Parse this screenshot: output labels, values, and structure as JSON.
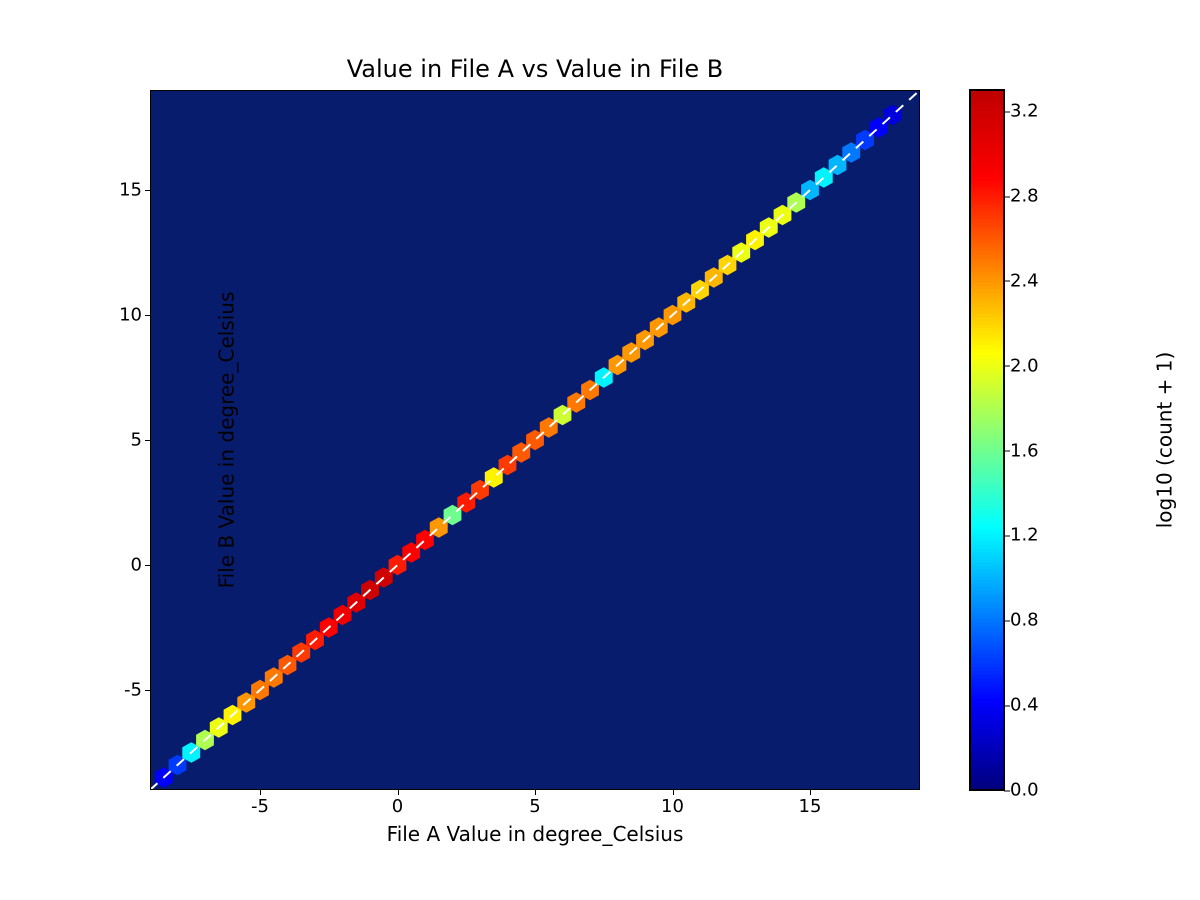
{
  "chart_data": {
    "type": "heatmap",
    "title": "Value in File A vs Value in File B",
    "xlabel": "File A Value in degree_Celsius",
    "ylabel": "File B Value in degree_Celsius",
    "xlim": [
      -9,
      19
    ],
    "ylim": [
      -9,
      19
    ],
    "xticks": [
      -5,
      0,
      5,
      10,
      15
    ],
    "yticks": [
      -5,
      0,
      5,
      10,
      15
    ],
    "colormap": "jet",
    "colorbar": {
      "label": "log10 (count + 1)",
      "min": 0.0,
      "max": 3.3,
      "ticks": [
        0.0,
        0.4,
        0.8,
        1.2,
        1.6,
        2.0,
        2.4,
        2.8,
        3.2
      ]
    },
    "overlay_line": {
      "style": "dashed",
      "color": "white",
      "equation": "y = x"
    },
    "diagonal_points": [
      {
        "x": -8.5,
        "v": 0.4
      },
      {
        "x": -8.0,
        "v": 0.6
      },
      {
        "x": -7.5,
        "v": 1.2
      },
      {
        "x": -7.0,
        "v": 1.8
      },
      {
        "x": -6.5,
        "v": 2.0
      },
      {
        "x": -6.0,
        "v": 2.1
      },
      {
        "x": -5.5,
        "v": 2.4
      },
      {
        "x": -5.0,
        "v": 2.5
      },
      {
        "x": -4.5,
        "v": 2.5
      },
      {
        "x": -4.0,
        "v": 2.6
      },
      {
        "x": -3.5,
        "v": 2.7
      },
      {
        "x": -3.0,
        "v": 2.8
      },
      {
        "x": -2.5,
        "v": 2.9
      },
      {
        "x": -2.0,
        "v": 3.0
      },
      {
        "x": -1.5,
        "v": 3.1
      },
      {
        "x": -1.0,
        "v": 3.2
      },
      {
        "x": -0.5,
        "v": 3.2
      },
      {
        "x": 0.0,
        "v": 2.8
      },
      {
        "x": 0.5,
        "v": 2.9
      },
      {
        "x": 1.0,
        "v": 2.9
      },
      {
        "x": 1.5,
        "v": 2.4
      },
      {
        "x": 2.0,
        "v": 1.6
      },
      {
        "x": 2.5,
        "v": 2.8
      },
      {
        "x": 3.0,
        "v": 2.7
      },
      {
        "x": 3.5,
        "v": 2.1
      },
      {
        "x": 4.0,
        "v": 2.7
      },
      {
        "x": 4.5,
        "v": 2.6
      },
      {
        "x": 5.0,
        "v": 2.6
      },
      {
        "x": 5.5,
        "v": 2.5
      },
      {
        "x": 6.0,
        "v": 1.9
      },
      {
        "x": 6.5,
        "v": 2.5
      },
      {
        "x": 7.0,
        "v": 2.5
      },
      {
        "x": 7.5,
        "v": 1.2
      },
      {
        "x": 8.0,
        "v": 2.4
      },
      {
        "x": 8.5,
        "v": 2.4
      },
      {
        "x": 9.0,
        "v": 2.4
      },
      {
        "x": 9.5,
        "v": 2.4
      },
      {
        "x": 10.0,
        "v": 2.4
      },
      {
        "x": 10.5,
        "v": 2.3
      },
      {
        "x": 11.0,
        "v": 2.2
      },
      {
        "x": 11.5,
        "v": 2.3
      },
      {
        "x": 12.0,
        "v": 2.2
      },
      {
        "x": 12.5,
        "v": 2.0
      },
      {
        "x": 13.0,
        "v": 2.1
      },
      {
        "x": 13.5,
        "v": 2.0
      },
      {
        "x": 14.0,
        "v": 2.0
      },
      {
        "x": 14.5,
        "v": 1.8
      },
      {
        "x": 15.0,
        "v": 1.0
      },
      {
        "x": 15.5,
        "v": 1.2
      },
      {
        "x": 16.0,
        "v": 1.0
      },
      {
        "x": 16.5,
        "v": 0.8
      },
      {
        "x": 17.0,
        "v": 0.6
      },
      {
        "x": 17.5,
        "v": 0.4
      },
      {
        "x": 18.0,
        "v": 0.3
      }
    ]
  }
}
